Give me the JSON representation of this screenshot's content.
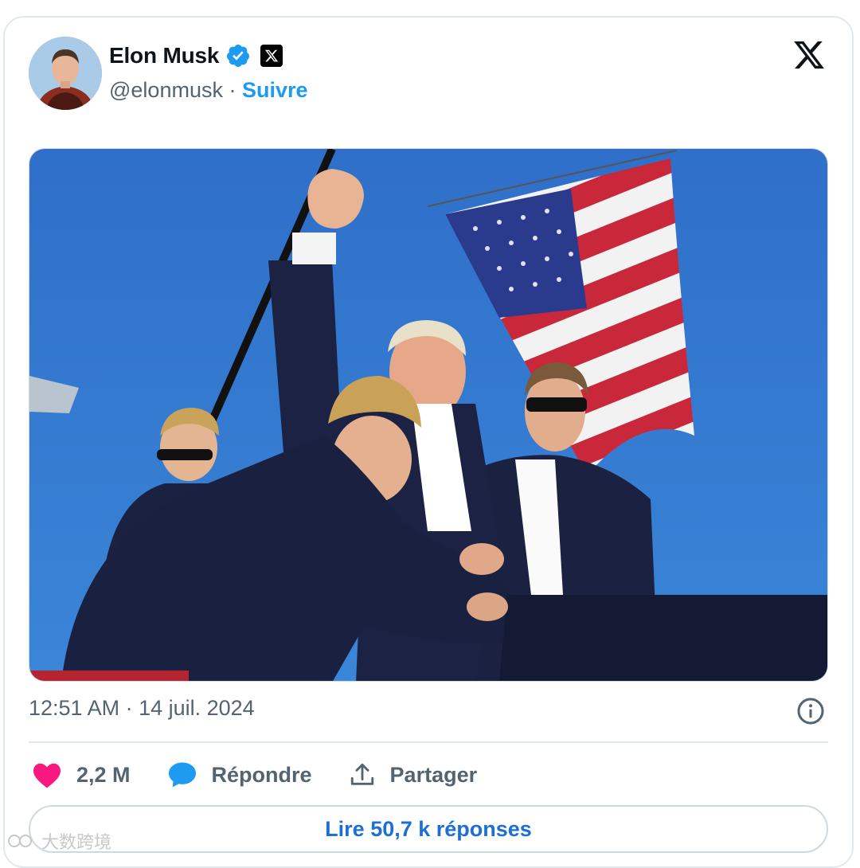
{
  "tweet": {
    "author_name": "Elon Musk",
    "author_handle": "@elonmusk",
    "separator": " · ",
    "follow_label": "Suivre",
    "timestamp": "12:51 AM · 14 juil. 2024"
  },
  "actions": {
    "like_count": "2,2 M",
    "reply_label": "Répondre",
    "share_label": "Partager"
  },
  "read_replies_label": "Lire 50,7 k réponses",
  "watermark": "大数跨境",
  "icons": {
    "verified": "verified-badge-icon",
    "x_logo": "x-logo-icon",
    "info": "info-icon",
    "like": "heart-icon",
    "reply": "speech-bubble-icon",
    "share": "share-upload-icon"
  },
  "colors": {
    "accent": "#1d9bf0",
    "heart": "#f91880",
    "text_secondary": "#536471"
  }
}
